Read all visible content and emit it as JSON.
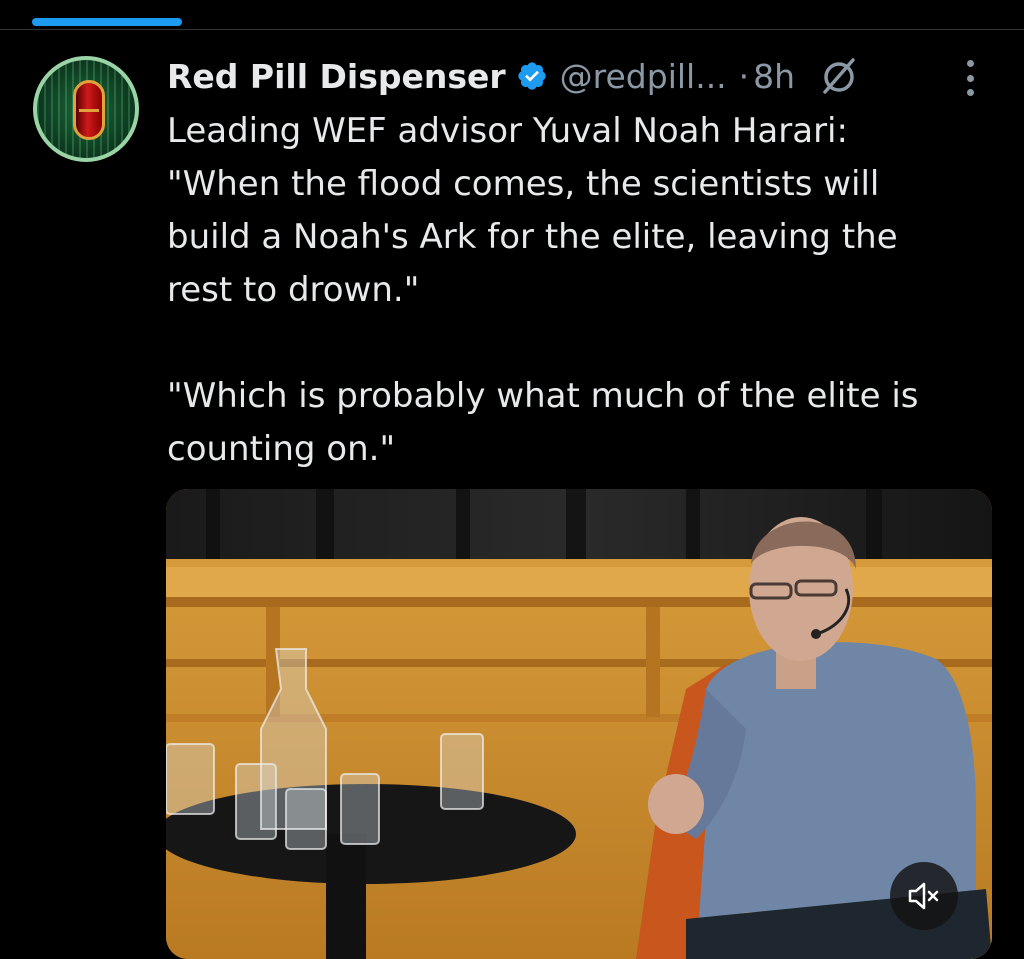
{
  "tweet": {
    "author_name": "Red Pill Dispenser",
    "author_handle": "@redpill...",
    "separator": "·",
    "timestamp": "8h",
    "text_lines": [
      "Leading WEF advisor Yuval Noah Harari:",
      "\"When the flood comes, the scientists will",
      "build a Noah's Ark for the elite, leaving the",
      "rest to drown.\"",
      "\"Which is probably what much of the elite is",
      "counting on.\""
    ]
  },
  "icons": {
    "verified": "verified-badge-icon",
    "grok": "grok-icon",
    "more": "more-options-icon",
    "mute": "muted-speaker-icon"
  },
  "colors": {
    "accent": "#1d9bf0",
    "text": "#e7e9ea",
    "muted": "#8b98a5",
    "background": "#000000"
  }
}
